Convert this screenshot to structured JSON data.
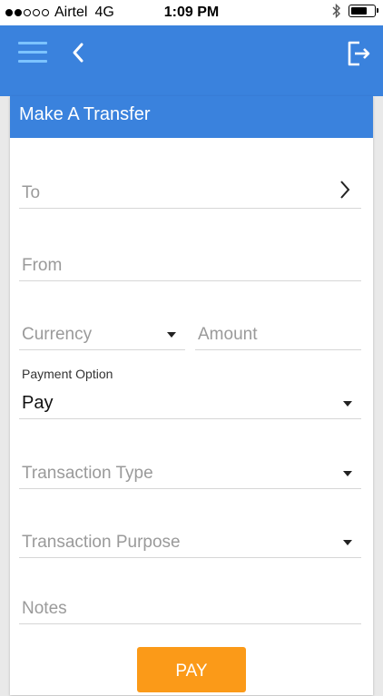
{
  "status_bar": {
    "carrier": "Airtel",
    "network": "4G",
    "time": "1:09 PM",
    "signal_filled": 2,
    "signal_total": 5,
    "battery_level": 0.75
  },
  "app_bar": {
    "menu_icon": "hamburger-menu-icon",
    "back_icon": "chevron-left-icon",
    "logout_icon": "logout-icon",
    "accent_color": "#3a82dd"
  },
  "form": {
    "title": "Make A Transfer",
    "to_placeholder": "To",
    "from_placeholder": "From",
    "currency_placeholder": "Currency",
    "amount_placeholder": "Amount",
    "payment_option_label": "Payment Option",
    "payment_option_value": "Pay",
    "transaction_type_placeholder": "Transaction Type",
    "transaction_purpose_placeholder": "Transaction Purpose",
    "notes_placeholder": "Notes",
    "pay_button_label": "PAY",
    "pay_button_color": "#fb9a18"
  }
}
